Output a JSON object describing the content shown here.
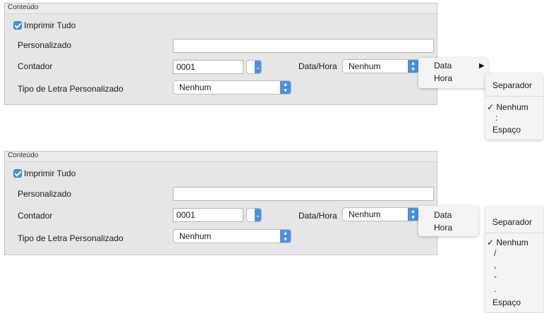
{
  "panel_top": {
    "title": "Conteúdo",
    "print_all": {
      "label": "Imprimir Tudo",
      "checked": true
    },
    "custom_label": "Personalizado",
    "custom_value": "",
    "counter_label": "Contador",
    "counter_value": "0001",
    "datetime_label": "Data/Hora",
    "datetime_value": "Nenhum",
    "font_label": "Tipo de Letra Personalizado",
    "font_value": "Nenhum"
  },
  "menu_top": {
    "items": [
      "Data",
      "Hora"
    ],
    "submenu_arrow": "▶"
  },
  "submenu_top": {
    "title": "Separador",
    "items": [
      "✓ Nenhum",
      ":",
      "Espaço"
    ]
  },
  "panel_bottom": {
    "title": "Conteúdo",
    "print_all": {
      "label": "Imprimir Tudo",
      "checked": true
    },
    "custom_label": "Personalizado",
    "custom_value": "",
    "counter_label": "Contador",
    "counter_value": "0001",
    "datetime_label": "Data/Hora",
    "datetime_value": "Nenhum",
    "font_label": "Tipo de Letra Personalizado",
    "font_value": "Nenhum"
  },
  "menu_bottom": {
    "items": [
      "Data",
      "Hora"
    ]
  },
  "submenu_bottom": {
    "title": "Separador",
    "items": [
      "✓ Nenhum",
      "/",
      ",",
      "-",
      ".",
      "Espaço"
    ]
  },
  "icons": {
    "checkbox": "checkmark-icon",
    "select_arrow": "updown-chevron-icon",
    "submenu_arrow": "triangle-right-icon"
  },
  "colors": {
    "accent": "#4a90e2",
    "panel_bg": "#e6e6e6"
  }
}
